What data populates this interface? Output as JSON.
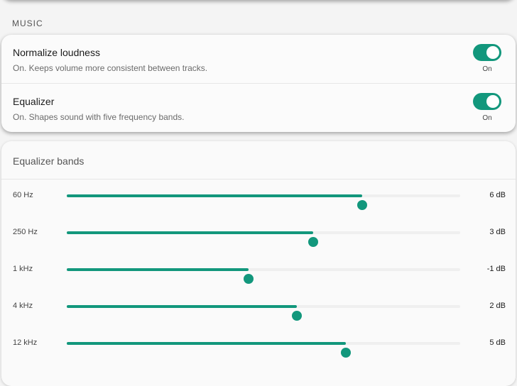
{
  "section": {
    "label": "MUSIC"
  },
  "settings": [
    {
      "title": "Normalize loudness",
      "description": "On. Keeps volume more consistent between tracks.",
      "state_label": "On",
      "enabled": true
    },
    {
      "title": "Equalizer",
      "description": "On. Shapes sound with five frequency bands.",
      "state_label": "On",
      "enabled": true
    }
  ],
  "equalizer": {
    "title": "Equalizer bands",
    "bands": [
      {
        "label": "60 Hz",
        "value": "6 dB",
        "level": 0.75
      },
      {
        "label": "250 Hz",
        "value": "3 dB",
        "level": 0.627
      },
      {
        "label": "1 kHz",
        "value": "-1 dB",
        "level": 0.462
      },
      {
        "label": "4 kHz",
        "value": "2 dB",
        "level": 0.585
      },
      {
        "label": "12 kHz",
        "value": "5 dB",
        "level": 0.709
      }
    ]
  },
  "colors": {
    "accent": "#12977c",
    "track": "#efefef"
  }
}
